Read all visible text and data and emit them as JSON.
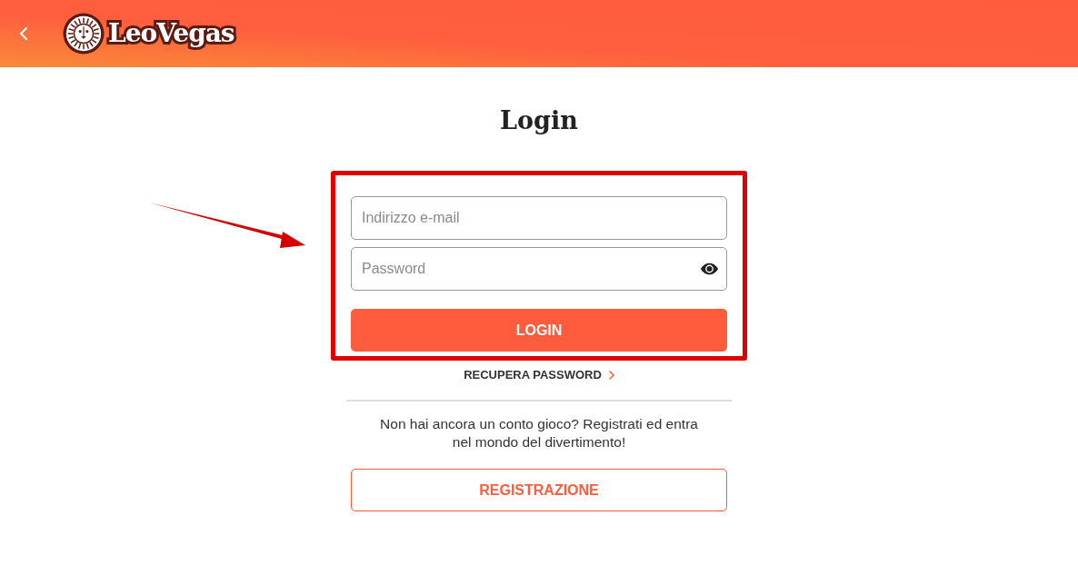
{
  "header": {
    "logo_text": "LeoVegas"
  },
  "title": "Login",
  "form": {
    "email": {
      "placeholder": "Indirizzo e-mail"
    },
    "password": {
      "placeholder": "Password"
    },
    "login_button": "LOGIN"
  },
  "recover_link": "RECUPERA PASSWORD",
  "signup_prompt": "Non hai ancora un conto gioco? Registrati ed entra nel mondo del divertimento!",
  "register_button": "REGISTRAZIONE"
}
